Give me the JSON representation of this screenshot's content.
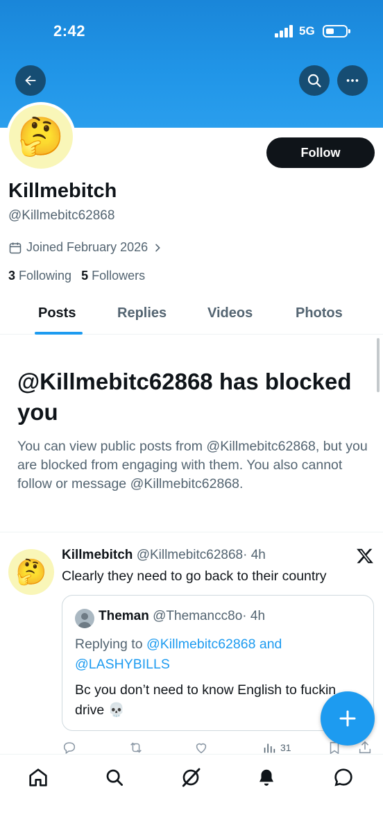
{
  "status_bar": {
    "time": "2:42",
    "network": "5G"
  },
  "profile": {
    "display_name": "Killmebitch",
    "handle": "@Killmebitc62868",
    "joined": "Joined February 2026",
    "following_count": "3",
    "following_label": "Following",
    "followers_count": "5",
    "followers_label": "Followers",
    "follow_button": "Follow",
    "avatar_emoji": "🤔"
  },
  "tabs": [
    {
      "label": "Posts",
      "active": true
    },
    {
      "label": "Replies",
      "active": false
    },
    {
      "label": "Videos",
      "active": false
    },
    {
      "label": "Photos",
      "active": false
    }
  ],
  "blocked": {
    "title": "@Killmebitc62868 has blocked you",
    "text": "You can view public posts from @Killmebitc62868, but you are blocked from engaging with them. You also cannot follow or message @Killmebitc62868."
  },
  "tweet": {
    "name": "Killmebitch",
    "handle": "@Killmebitc62868",
    "time": "· 4h",
    "text": "Clearly they need to go back to their country",
    "avatar_emoji": "🤔",
    "views": "31",
    "quote": {
      "name": "Theman",
      "handle": "@Themancc8o",
      "time": "· 4h",
      "replying_prefix": "Replying to ",
      "replying_to": "@Killmebitc62868 and @LASHYBILLS",
      "text": "Bc you don’t need to know English to fuckin drive 💀"
    }
  },
  "colors": {
    "accent": "#1d9bf0",
    "banner": "#2196e8",
    "text_primary": "#0f1419",
    "text_secondary": "#536471"
  },
  "icons": [
    "back-arrow-icon",
    "search-icon",
    "more-icon",
    "calendar-icon",
    "chevron-right-icon",
    "x-logo-icon",
    "reply-icon",
    "repost-icon",
    "like-icon",
    "views-icon",
    "bookmark-icon",
    "share-icon",
    "plus-icon",
    "home-icon",
    "grok-icon",
    "bell-icon",
    "messages-icon"
  ]
}
